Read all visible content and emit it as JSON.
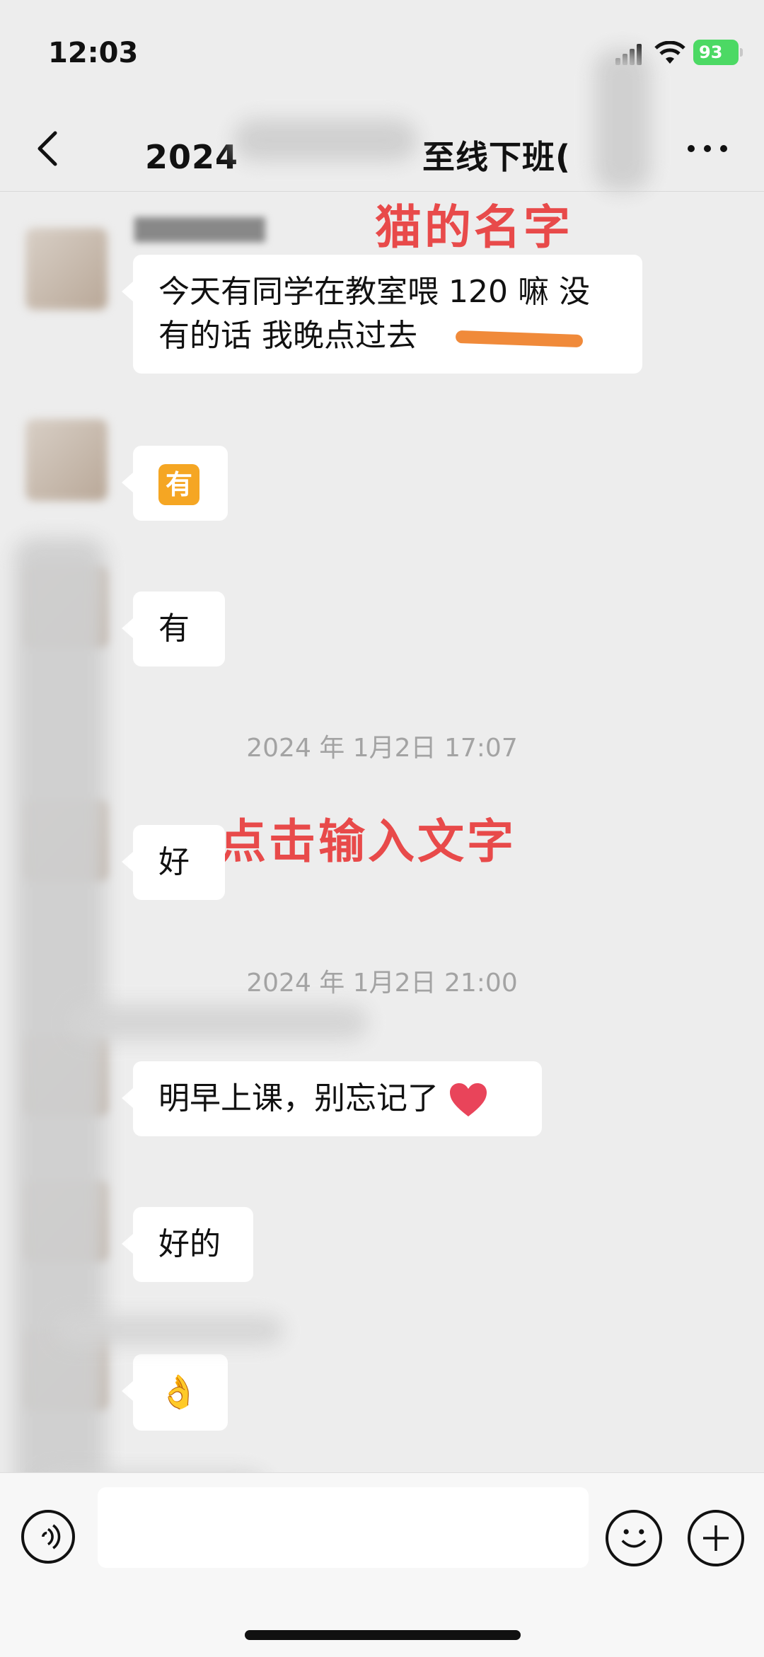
{
  "status_bar": {
    "time": "12:03",
    "battery": "93"
  },
  "nav": {
    "title": "2024",
    "title_tail": "至线下班("
  },
  "annotations": {
    "cat_name": "猫的名字",
    "tap_to_type": "点击输入文字"
  },
  "messages": [
    {
      "text": "今天有同学在教室喂 120 嘛 没有的话 我晚点过去"
    },
    {
      "emoji": "有"
    },
    {
      "text": "有"
    },
    {
      "text": "好"
    },
    {
      "text": "明早上课，别忘记了"
    },
    {
      "text": "好的"
    },
    {
      "emoji": "👌"
    }
  ],
  "dividers": [
    "2024 年 1月2日 17:07",
    "2024 年 1月2日 21:00"
  ],
  "input": {
    "placeholder": ""
  },
  "icons": [
    "back-icon",
    "more-icon",
    "voice-icon",
    "emoji-icon",
    "plus-icon",
    "heart-emoji"
  ]
}
